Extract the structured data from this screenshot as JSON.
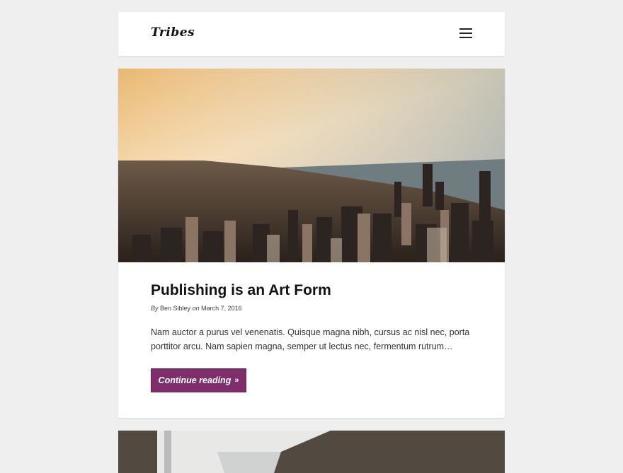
{
  "site": {
    "logo": "Tribes"
  },
  "header": {
    "menu_icon": "hamburger-menu-icon"
  },
  "post": {
    "title": "Publishing is an Art Form",
    "meta_by": "By",
    "author": "Ben Sibley",
    "meta_on": "on",
    "date": "March 7, 2016",
    "excerpt": "Nam auctor a purus vel venenatis. Quisque magna nibh, cursus ac nisl nec, porta porttitor arcu. Nam sapien magna, semper ut lectus nec, fermentum rutrum…",
    "continue_label": "Continue reading",
    "continue_icon": "double-chevron-right-icon",
    "image_alt": "city skyline at sunset"
  },
  "colors": {
    "accent": "#7e2f6b",
    "page_bg": "#efefef"
  }
}
